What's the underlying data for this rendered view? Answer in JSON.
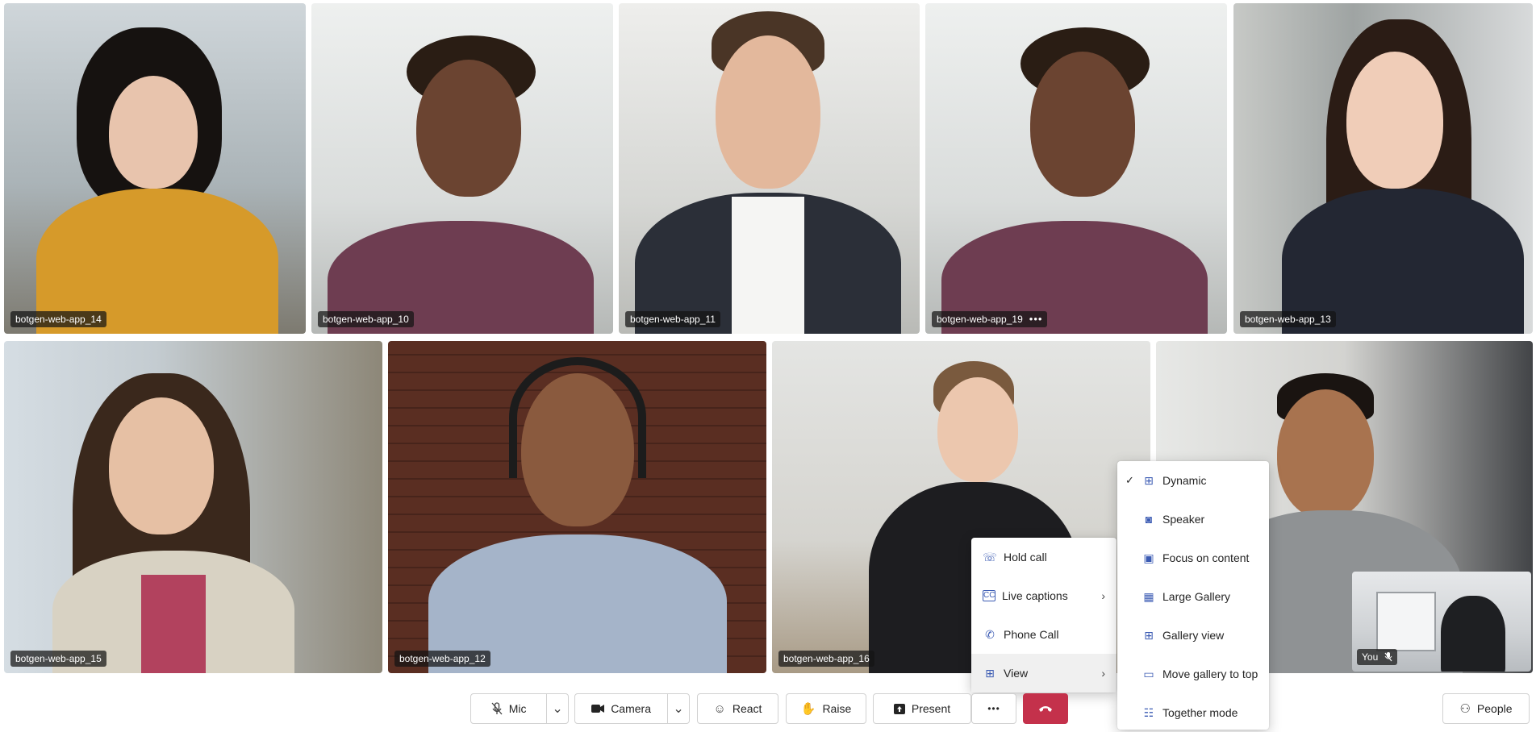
{
  "participants": [
    {
      "name": "botgen-web-app_14"
    },
    {
      "name": "botgen-web-app_10"
    },
    {
      "name": "botgen-web-app_11"
    },
    {
      "name": "botgen-web-app_19",
      "more": "•••"
    },
    {
      "name": "botgen-web-app_13"
    },
    {
      "name": "botgen-web-app_15"
    },
    {
      "name": "botgen-web-app_12"
    },
    {
      "name": "botgen-web-app_16"
    }
  ],
  "self_view": {
    "label": "You"
  },
  "controls": {
    "mic": "Mic",
    "camera": "Camera",
    "react": "React",
    "raise": "Raise",
    "present": "Present",
    "more": "•••",
    "people": "People"
  },
  "more_menu": {
    "items": [
      {
        "label": "Hold call",
        "icon": "hold-call-icon"
      },
      {
        "label": "Live captions",
        "icon": "captions-icon",
        "submenu": true
      },
      {
        "label": "Phone Call",
        "icon": "phone-icon"
      },
      {
        "label": "View",
        "icon": "view-grid-icon",
        "submenu": true,
        "selected": true
      }
    ]
  },
  "view_menu": {
    "items": [
      {
        "label": "Dynamic",
        "checked": true
      },
      {
        "label": "Speaker"
      },
      {
        "label": "Focus on content"
      },
      {
        "label": "Large Gallery"
      },
      {
        "label": "Gallery view"
      },
      {
        "label": "Move gallery to top"
      },
      {
        "label": "Together mode"
      }
    ]
  },
  "colors": {
    "hangup": "#c4314b",
    "menu_icon": "#3b5bb3"
  }
}
